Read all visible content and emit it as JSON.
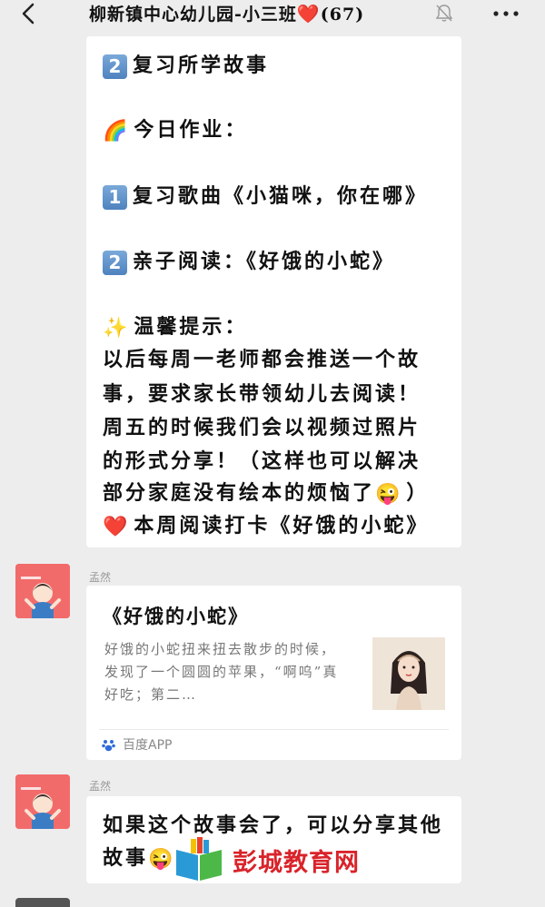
{
  "header": {
    "title": "柳新镇中心幼儿园-小三班",
    "heart": "❤️",
    "member_count": "(67)"
  },
  "message1": {
    "lines": [
      {
        "badge": "2",
        "text": "复习所学故事"
      },
      {
        "emoji": "🌈",
        "text": "今日作业："
      },
      {
        "badge": "1",
        "text": "复习歌曲《小猫咪，你在哪》"
      },
      {
        "badge": "2",
        "text": "亲子阅读：《好饿的小蛇》"
      },
      {
        "emoji": "✨",
        "text": "温馨提示："
      },
      {
        "text": "以后每周一老师都会推送一个故"
      },
      {
        "text": "事，要求家长带领幼儿去阅读！"
      },
      {
        "text": "周五的时候我们会以视频过照片"
      },
      {
        "text": "的形式分享！（这样也可以解决"
      },
      {
        "text": "部分家庭没有绘本的烦恼了",
        "emoji_after": "😜",
        "suffix": "）"
      },
      {
        "emoji": "❤️",
        "text": "本周阅读打卡《好饿的小蛇》"
      }
    ]
  },
  "message2": {
    "sender": "孟然",
    "card": {
      "title": "《好饿的小蛇》",
      "desc": "好饿的小蛇扭来扭去散步的时候，发现了一个圆圆的苹果，“啊呜”真好吃；第二…",
      "source": "百度APP"
    }
  },
  "message3": {
    "sender": "孟然",
    "line1": "如果这个故事会了，可以分享其他",
    "line2": "故事",
    "emoji": "😜"
  },
  "watermark": {
    "text": "彭城教育网"
  },
  "colors": {
    "background": "#ededed",
    "bubble": "#ffffff",
    "badge": "#5b8fcc",
    "avatar": "#f26b6b",
    "watermark": "#d9232a"
  }
}
